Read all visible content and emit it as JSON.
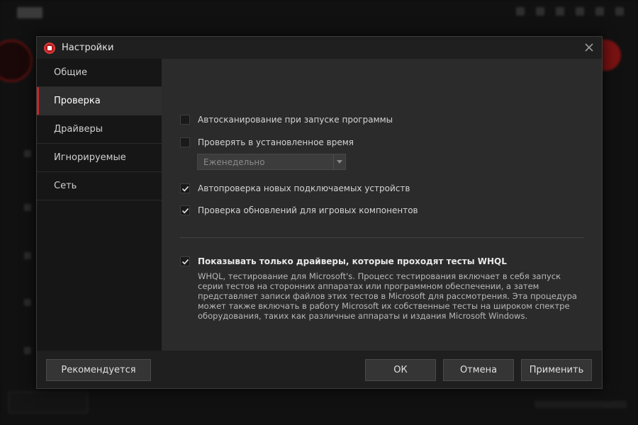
{
  "dialog": {
    "title": "Настройки"
  },
  "sidebar": {
    "items": [
      {
        "label": "Общие",
        "active": false
      },
      {
        "label": "Проверка",
        "active": true
      },
      {
        "label": "Драйверы",
        "active": false
      },
      {
        "label": "Игнорируемые",
        "active": false
      },
      {
        "label": "Сеть",
        "active": false
      }
    ]
  },
  "content": {
    "autoscan_label": "Автосканирование при запуске программы",
    "autoscan_checked": false,
    "scheduled_label": "Проверять в установленное время",
    "scheduled_checked": false,
    "schedule_select_value": "Еженедельно",
    "autocheck_devices_label": "Автопроверка новых подключаемых устройств",
    "autocheck_devices_checked": true,
    "game_updates_label": "Проверка обновлений для игровых компонентов",
    "game_updates_checked": true,
    "whql_label": "Показывать только драйверы, которые проходят тесты WHQL",
    "whql_checked": true,
    "whql_description": "WHQL, тестирование для Microsoft's. Процесс тестирования включает в себя запуск серии тестов на сторонних аппаратах или программном обеспечении, а затем представляет записи файлов этих тестов в Microsoft для рассмотрения. Эта процедура может также включать в работу Microsoft их собственные тесты на широком спектре оборудования, таких как различные аппараты и издания Microsoft Windows."
  },
  "footer": {
    "recommended_label": "Рекомендуется",
    "ok_label": "ОК",
    "cancel_label": "Отмена",
    "apply_label": "Применить"
  },
  "colors": {
    "accent_red": "#c0282d",
    "dialog_bg": "#2b2b2b",
    "sidebar_bg": "#161616"
  }
}
